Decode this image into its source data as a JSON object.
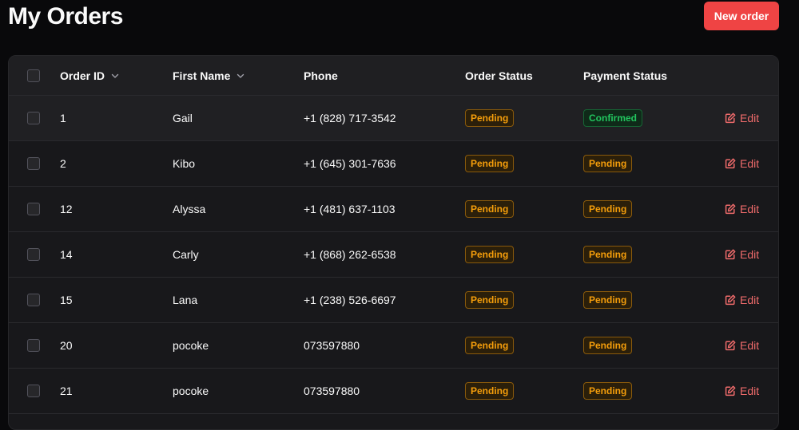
{
  "page": {
    "title": "My Orders",
    "new_order_label": "New order"
  },
  "table": {
    "columns": {
      "order_id": "Order ID",
      "first_name": "First Name",
      "phone": "Phone",
      "order_status": "Order Status",
      "payment_status": "Payment Status"
    },
    "edit_label": "Edit",
    "rows": [
      {
        "id": "1",
        "name": "Gail",
        "phone": "+1 (828) 717-3542",
        "order_status": "Pending",
        "payment_status": "Confirmed"
      },
      {
        "id": "2",
        "name": "Kibo",
        "phone": "+1 (645) 301-7636",
        "order_status": "Pending",
        "payment_status": "Pending"
      },
      {
        "id": "12",
        "name": "Alyssa",
        "phone": "+1 (481) 637-1103",
        "order_status": "Pending",
        "payment_status": "Pending"
      },
      {
        "id": "14",
        "name": "Carly",
        "phone": "+1 (868) 262-6538",
        "order_status": "Pending",
        "payment_status": "Pending"
      },
      {
        "id": "15",
        "name": "Lana",
        "phone": "+1 (238) 526-6697",
        "order_status": "Pending",
        "payment_status": "Pending"
      },
      {
        "id": "20",
        "name": "pocoke",
        "phone": "073597880",
        "order_status": "Pending",
        "payment_status": "Pending"
      },
      {
        "id": "21",
        "name": "pocoke",
        "phone": "073597880",
        "order_status": "Pending",
        "payment_status": "Pending"
      }
    ]
  },
  "colors": {
    "accent": "#ef4444",
    "pending": "#f59e0b",
    "confirmed": "#22c55e"
  }
}
